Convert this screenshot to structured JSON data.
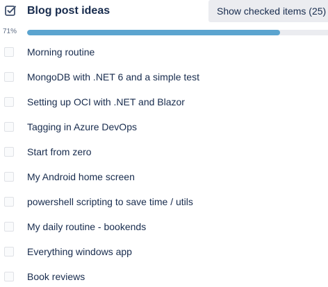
{
  "checklist": {
    "title": "Blog post ideas",
    "toggle_label": "Show checked items (25)",
    "progress_label": "71%",
    "progress_fraction": 0.71,
    "accent_color": "#5ba4cf",
    "icon": "checkbox-checked-icon",
    "items": [
      {
        "label": "Morning routine",
        "checked": false
      },
      {
        "label": "MongoDB with .NET 6 and a simple test",
        "checked": false
      },
      {
        "label": "Setting up OCI with .NET and Blazor",
        "checked": false
      },
      {
        "label": "Tagging in Azure DevOps",
        "checked": false
      },
      {
        "label": "Start from zero",
        "checked": false
      },
      {
        "label": "My Android home screen",
        "checked": false
      },
      {
        "label": "powershell scripting to save time / utils",
        "checked": false
      },
      {
        "label": "My daily routine - bookends",
        "checked": false
      },
      {
        "label": "Everything windows app",
        "checked": false
      },
      {
        "label": "Book reviews",
        "checked": false
      }
    ]
  }
}
